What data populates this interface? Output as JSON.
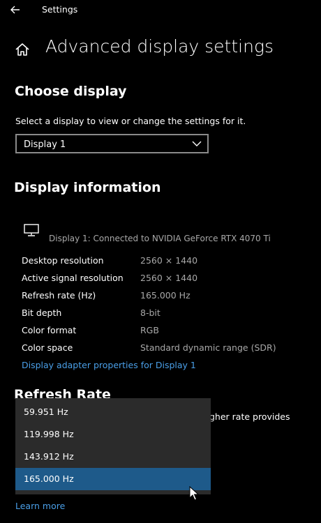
{
  "window": {
    "title": "Settings"
  },
  "page": {
    "title": "Advanced display settings"
  },
  "choose_display": {
    "heading": "Choose display",
    "description": "Select a display to view or change the settings for it.",
    "selected": "Display 1"
  },
  "display_info": {
    "heading": "Display information",
    "connected_text": "Display 1: Connected to NVIDIA GeForce RTX 4070 Ti",
    "rows": [
      {
        "label": "Desktop resolution",
        "value": "2560 × 1440"
      },
      {
        "label": "Active signal resolution",
        "value": "2560 × 1440"
      },
      {
        "label": "Refresh rate (Hz)",
        "value": "165.000 Hz"
      },
      {
        "label": "Bit depth",
        "value": "8-bit"
      },
      {
        "label": "Color format",
        "value": "RGB"
      },
      {
        "label": "Color space",
        "value": "Standard dynamic range (SDR)"
      }
    ],
    "adapter_link": "Display adapter properties for Display 1"
  },
  "refresh_rate": {
    "heading": "Refresh Rate",
    "partial_description": "gher rate provides",
    "options": [
      "59.951 Hz",
      "119.998 Hz",
      "143.912 Hz",
      "165.000 Hz"
    ],
    "selected_index": 3,
    "learn_more": "Learn more"
  },
  "colors": {
    "background": "#000000",
    "link": "#4a9fe8",
    "dropdown_bg": "#2b2b2b",
    "selected_bg": "#1e5a8a",
    "secondary_text": "#a8a8a8"
  },
  "icons": {
    "back": "back-arrow-icon",
    "home": "home-icon",
    "monitor": "monitor-icon",
    "chevron": "chevron-down-icon",
    "cursor": "mouse-cursor-icon"
  }
}
